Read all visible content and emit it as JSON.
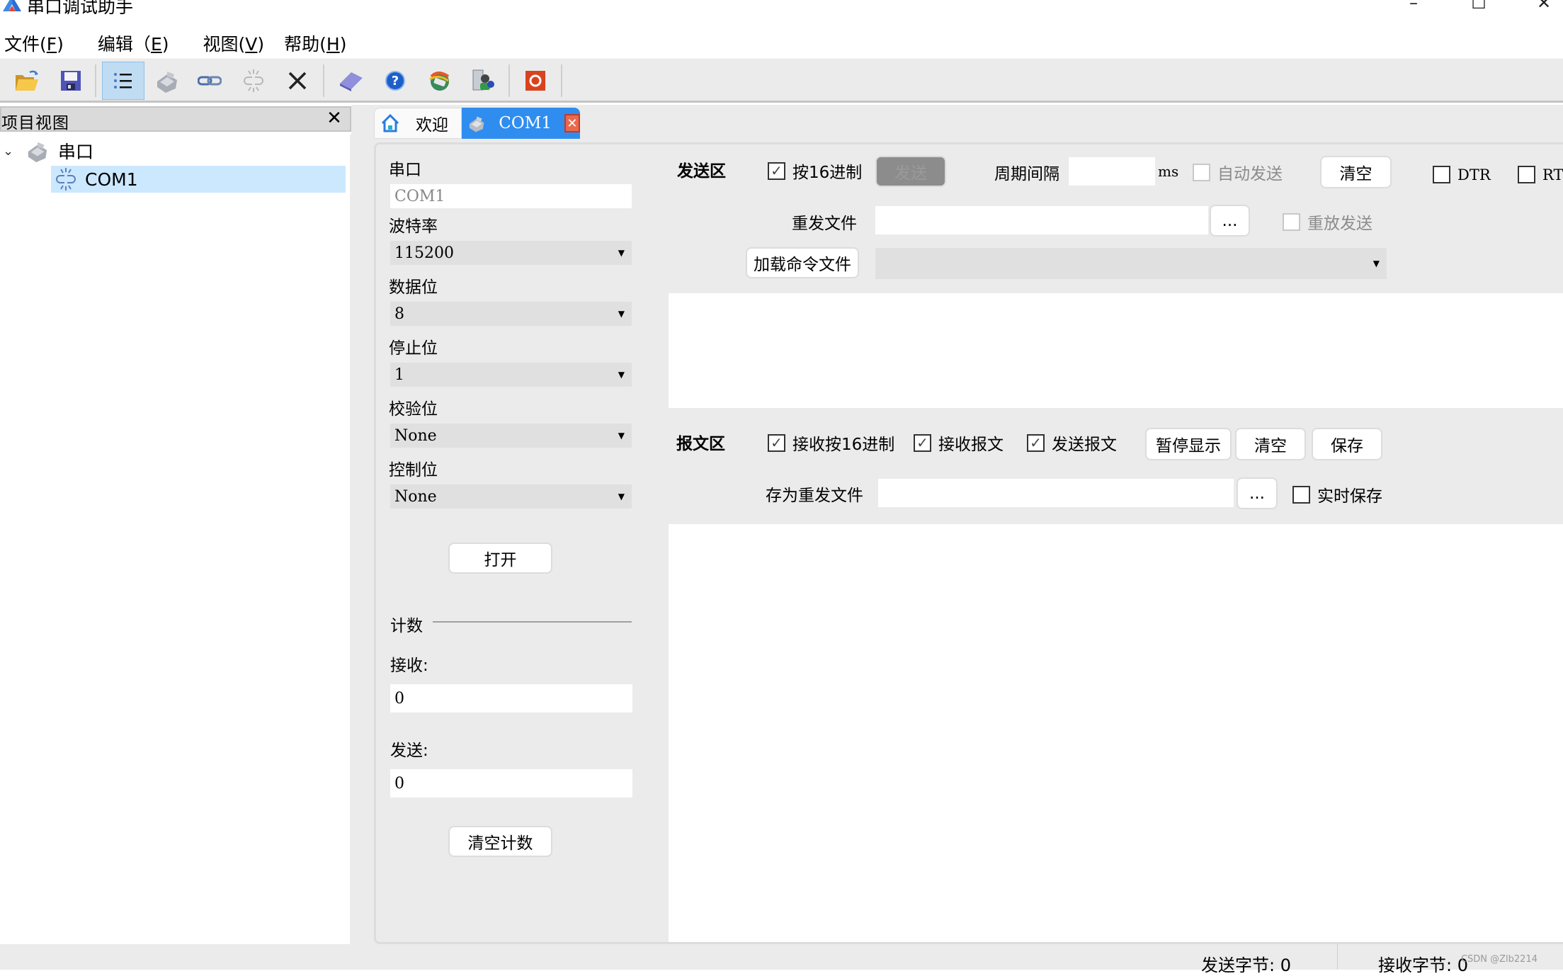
{
  "window": {
    "title": "串口调试助手",
    "controls": {
      "minimize": "–",
      "maximize": "☐",
      "close": "✕"
    }
  },
  "menu": [
    {
      "label": "文件(",
      "key": "F",
      "suffix": ")"
    },
    {
      "label": "编辑（",
      "key": "E",
      "suffix": ")"
    },
    {
      "label": "视图(",
      "key": "V",
      "suffix": ")"
    },
    {
      "label": "帮助(",
      "key": "H",
      "suffix": ")"
    }
  ],
  "toolbar": {
    "buttons": [
      {
        "name": "open-folder-icon",
        "active": false
      },
      {
        "name": "save-floppy-icon",
        "active": false
      },
      {
        "name": "list-view-icon",
        "active": true
      },
      {
        "name": "serial-port-device-icon",
        "active": false
      },
      {
        "name": "connect-link-icon",
        "active": false
      },
      {
        "name": "disconnect-link-icon",
        "active": false
      },
      {
        "name": "delete-x-icon",
        "active": false
      },
      {
        "name": "book-icon",
        "active": false
      },
      {
        "name": "help-question-icon",
        "active": false
      },
      {
        "name": "network-globe-icon",
        "active": false
      },
      {
        "name": "computer-users-icon",
        "active": false
      },
      {
        "name": "stop-record-icon",
        "active": false
      }
    ]
  },
  "project_view": {
    "title": "项目视图",
    "close": "✕",
    "tree": {
      "root": {
        "label": "串口",
        "expanded": true
      },
      "children": [
        {
          "label": "COM1",
          "selected": true
        }
      ]
    }
  },
  "tabs": [
    {
      "label": "欢迎",
      "icon": "home-icon",
      "active": false
    },
    {
      "label": "COM1",
      "icon": "serial-port-device-icon",
      "active": true,
      "closable": true
    }
  ],
  "serial_settings": {
    "port_label": "串口",
    "port_value": "COM1",
    "baud_label": "波特率",
    "baud_value": "115200",
    "databits_label": "数据位",
    "databits_value": "8",
    "stopbits_label": "停止位",
    "stopbits_value": "1",
    "parity_label": "校验位",
    "parity_value": "None",
    "flow_label": "控制位",
    "flow_value": "None",
    "open_button": "打开",
    "count_label": "计数",
    "recv_label": "接收:",
    "recv_value": "0",
    "send_label": "发送:",
    "send_value": "0",
    "clear_count_button": "清空计数"
  },
  "send_area": {
    "title": "发送区",
    "hex_checkbox": {
      "label": "按16进制",
      "checked": true
    },
    "send_button": "发送",
    "period_label": "周期间隔",
    "period_value": "",
    "period_unit": "ms",
    "auto_send": {
      "label": "自动发送",
      "checked": false,
      "disabled": true
    },
    "clear_button": "清空",
    "dtr": {
      "label": "DTR",
      "checked": false
    },
    "rts": {
      "label": "RTS",
      "checked": false
    },
    "resend_file_label": "重发文件",
    "resend_file_value": "",
    "browse_button": "...",
    "replay_send": {
      "label": "重放发送",
      "checked": false,
      "disabled": true
    },
    "load_cmd_button": "加载命令文件",
    "cmd_select_value": "",
    "send_text": ""
  },
  "report_area": {
    "title": "报文区",
    "recv_hex": {
      "label": "接收按16进制",
      "checked": true
    },
    "recv_msg": {
      "label": "接收报文",
      "checked": true
    },
    "send_msg": {
      "label": "发送报文",
      "checked": true
    },
    "pause_button": "暂停显示",
    "clear_button": "清空",
    "save_button": "保存",
    "save_as_label": "存为重发文件",
    "save_as_value": "",
    "browse_button": "...",
    "realtime_save": {
      "label": "实时保存",
      "checked": false
    },
    "log_text": ""
  },
  "status_bar": {
    "sent_bytes": "发送字节: 0",
    "recv_bytes": "接收字节: 0",
    "watermark": "CSDN @Zlb2214"
  },
  "colors": {
    "accent_tab": "#2f8df0",
    "selection": "#cce8ff",
    "panel_bg": "#ebebeb"
  }
}
